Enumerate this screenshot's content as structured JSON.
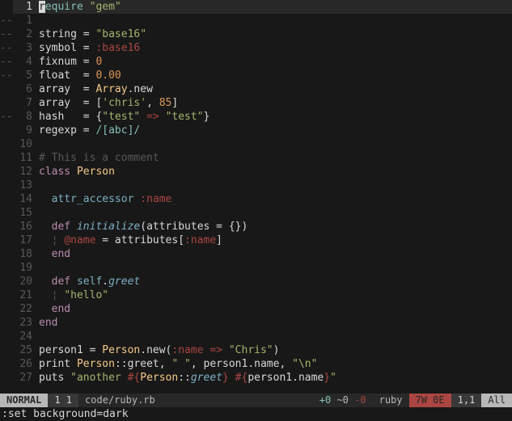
{
  "statusline": {
    "mode": "NORMAL",
    "buffers": "1 1",
    "file": "code/ruby.rb",
    "hunks_add": "+0",
    "hunks_mod": "~0",
    "hunks_del": "-0",
    "filetype": "ruby",
    "warnings": "7W 0E",
    "position": "1,1",
    "percent": "All"
  },
  "cmdline": ":set background=dark",
  "lines": [
    {
      "n": 1,
      "sign": "",
      "cursor": true,
      "tokens": [
        [
          "cursor",
          "r"
        ],
        [
          "c-require",
          "equire"
        ],
        [
          "c-punc",
          " "
        ],
        [
          "c-str",
          "\"gem\""
        ]
      ]
    },
    {
      "n": 1,
      "sign": "--",
      "relnum": true,
      "tokens": []
    },
    {
      "n": 2,
      "sign": "--",
      "relnum": true,
      "tokens": [
        [
          "c-punc",
          "string = "
        ],
        [
          "c-str",
          "\"base16\""
        ]
      ]
    },
    {
      "n": 3,
      "sign": "--",
      "relnum": true,
      "tokens": [
        [
          "c-punc",
          "symbol = "
        ],
        [
          "c-sym",
          ":base16"
        ]
      ]
    },
    {
      "n": 4,
      "sign": "--",
      "relnum": true,
      "tokens": [
        [
          "c-punc",
          "fixnum = "
        ],
        [
          "c-num",
          "0"
        ]
      ]
    },
    {
      "n": 5,
      "sign": "--",
      "relnum": true,
      "tokens": [
        [
          "c-punc",
          "float  = "
        ],
        [
          "c-num",
          "0.00"
        ]
      ]
    },
    {
      "n": 6,
      "sign": "",
      "relnum": true,
      "tokens": [
        [
          "c-punc",
          "array  = "
        ],
        [
          "c-const",
          "Array"
        ],
        [
          "c-punc",
          ".new"
        ]
      ]
    },
    {
      "n": 7,
      "sign": "",
      "relnum": true,
      "tokens": [
        [
          "c-punc",
          "array  = ["
        ],
        [
          "c-str",
          "'chris'"
        ],
        [
          "c-punc",
          ", "
        ],
        [
          "c-num",
          "85"
        ],
        [
          "c-punc",
          "]"
        ]
      ]
    },
    {
      "n": 8,
      "sign": "--",
      "relnum": true,
      "tokens": [
        [
          "c-punc",
          "hash   = {"
        ],
        [
          "c-str",
          "\"test\""
        ],
        [
          "c-punc",
          " "
        ],
        [
          "c-sym",
          "=>"
        ],
        [
          "c-punc",
          " "
        ],
        [
          "c-str",
          "\"test\""
        ],
        [
          "c-punc",
          "}"
        ]
      ]
    },
    {
      "n": 9,
      "sign": "",
      "relnum": true,
      "tokens": [
        [
          "c-punc",
          "regexp = "
        ],
        [
          "c-regex",
          "/[abc]/"
        ]
      ]
    },
    {
      "n": 10,
      "sign": "",
      "relnum": true,
      "tokens": []
    },
    {
      "n": 11,
      "sign": "",
      "relnum": true,
      "tokens": [
        [
          "c-comment",
          "# This is a comment"
        ]
      ]
    },
    {
      "n": 12,
      "sign": "",
      "relnum": true,
      "tokens": [
        [
          "c-kw",
          "class"
        ],
        [
          "c-punc",
          " "
        ],
        [
          "c-const",
          "Person"
        ]
      ]
    },
    {
      "n": 13,
      "sign": "",
      "relnum": true,
      "tokens": []
    },
    {
      "n": 14,
      "sign": "",
      "relnum": true,
      "tokens": [
        [
          "c-punc",
          "  "
        ],
        [
          "c-self",
          "attr_accessor"
        ],
        [
          "c-punc",
          " "
        ],
        [
          "c-sym",
          ":name"
        ]
      ]
    },
    {
      "n": 15,
      "sign": "",
      "relnum": true,
      "tokens": []
    },
    {
      "n": 16,
      "sign": "",
      "relnum": true,
      "tokens": [
        [
          "c-punc",
          "  "
        ],
        [
          "c-kw",
          "def"
        ],
        [
          "c-punc",
          " "
        ],
        [
          "c-fn",
          "initialize"
        ],
        [
          "c-punc",
          "(attributes = {})"
        ]
      ]
    },
    {
      "n": 17,
      "sign": "",
      "relnum": true,
      "tokens": [
        [
          "c-punc",
          "  "
        ],
        [
          "c-dim",
          "¦"
        ],
        [
          "c-punc",
          " "
        ],
        [
          "c-ivar",
          "@name"
        ],
        [
          "c-punc",
          " = attributes["
        ],
        [
          "c-sym",
          ":name"
        ],
        [
          "c-punc",
          "]"
        ]
      ]
    },
    {
      "n": 18,
      "sign": "",
      "relnum": true,
      "tokens": [
        [
          "c-punc",
          "  "
        ],
        [
          "c-kw",
          "end"
        ]
      ]
    },
    {
      "n": 19,
      "sign": "",
      "relnum": true,
      "tokens": []
    },
    {
      "n": 20,
      "sign": "",
      "relnum": true,
      "tokens": [
        [
          "c-punc",
          "  "
        ],
        [
          "c-kw",
          "def"
        ],
        [
          "c-punc",
          " "
        ],
        [
          "c-self",
          "self"
        ],
        [
          "c-punc",
          "."
        ],
        [
          "c-fn",
          "greet"
        ]
      ]
    },
    {
      "n": 21,
      "sign": "",
      "relnum": true,
      "tokens": [
        [
          "c-punc",
          "  "
        ],
        [
          "c-dim",
          "¦"
        ],
        [
          "c-punc",
          " "
        ],
        [
          "c-str",
          "\"hello\""
        ]
      ]
    },
    {
      "n": 22,
      "sign": "",
      "relnum": true,
      "tokens": [
        [
          "c-punc",
          "  "
        ],
        [
          "c-kw",
          "end"
        ]
      ]
    },
    {
      "n": 23,
      "sign": "",
      "relnum": true,
      "tokens": [
        [
          "c-kw",
          "end"
        ]
      ]
    },
    {
      "n": 24,
      "sign": "",
      "relnum": true,
      "tokens": []
    },
    {
      "n": 25,
      "sign": "",
      "relnum": true,
      "tokens": [
        [
          "c-punc",
          "person1 = "
        ],
        [
          "c-const",
          "Person"
        ],
        [
          "c-punc",
          ".new("
        ],
        [
          "c-sym",
          ":name"
        ],
        [
          "c-punc",
          " "
        ],
        [
          "c-sym",
          "=>"
        ],
        [
          "c-punc",
          " "
        ],
        [
          "c-str",
          "\"Chris\""
        ],
        [
          "c-punc",
          ")"
        ]
      ]
    },
    {
      "n": 26,
      "sign": "",
      "relnum": true,
      "tokens": [
        [
          "c-punc",
          "print "
        ],
        [
          "c-const",
          "Person"
        ],
        [
          "c-punc",
          "::greet, "
        ],
        [
          "c-str",
          "\" \""
        ],
        [
          "c-punc",
          ", person1.name, "
        ],
        [
          "c-str",
          "\"\\n\""
        ]
      ]
    },
    {
      "n": 27,
      "sign": "",
      "relnum": true,
      "tokens": [
        [
          "c-punc",
          "puts "
        ],
        [
          "c-str",
          "\"another "
        ],
        [
          "c-sym",
          "#{"
        ],
        [
          "c-const",
          "Person"
        ],
        [
          "c-punc",
          "::"
        ],
        [
          "c-fn",
          "greet"
        ],
        [
          "c-sym",
          "}"
        ],
        [
          "c-str",
          " "
        ],
        [
          "c-sym",
          "#{"
        ],
        [
          "c-punc",
          "person1.name"
        ],
        [
          "c-sym",
          "}"
        ],
        [
          "c-str",
          "\""
        ]
      ]
    }
  ]
}
